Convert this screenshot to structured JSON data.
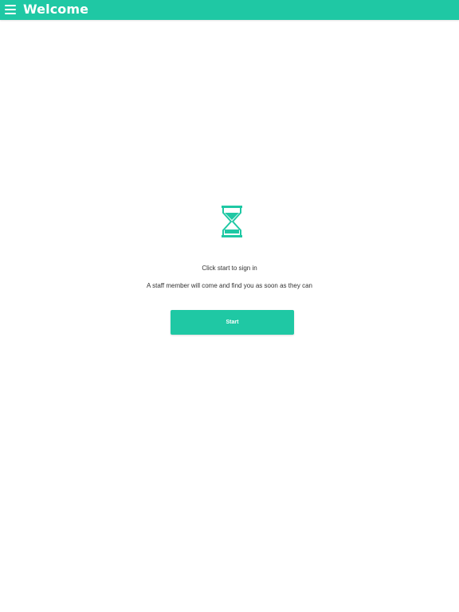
{
  "app_bar": {
    "title": "Welcome",
    "menu_icon": "hamburger-menu-icon",
    "color": "#1fc8a4"
  },
  "main": {
    "illustration_icon": "hourglass-icon",
    "instruction": "Click start to sign in",
    "subtext": "A staff member will come and find you as soon as they can",
    "start_label": "Start"
  },
  "colors": {
    "accent": "#1fc8a4",
    "text": "#333333",
    "background": "#ffffff"
  }
}
